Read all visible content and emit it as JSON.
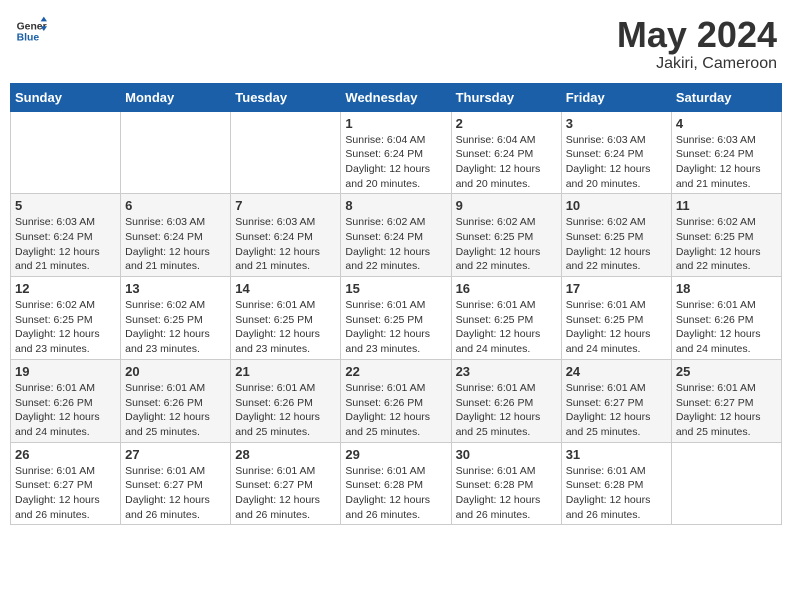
{
  "header": {
    "logo_line1": "General",
    "logo_line2": "Blue",
    "month": "May 2024",
    "location": "Jakiri, Cameroon"
  },
  "weekdays": [
    "Sunday",
    "Monday",
    "Tuesday",
    "Wednesday",
    "Thursday",
    "Friday",
    "Saturday"
  ],
  "weeks": [
    [
      {
        "day": "",
        "info": ""
      },
      {
        "day": "",
        "info": ""
      },
      {
        "day": "",
        "info": ""
      },
      {
        "day": "1",
        "info": "Sunrise: 6:04 AM\nSunset: 6:24 PM\nDaylight: 12 hours\nand 20 minutes."
      },
      {
        "day": "2",
        "info": "Sunrise: 6:04 AM\nSunset: 6:24 PM\nDaylight: 12 hours\nand 20 minutes."
      },
      {
        "day": "3",
        "info": "Sunrise: 6:03 AM\nSunset: 6:24 PM\nDaylight: 12 hours\nand 20 minutes."
      },
      {
        "day": "4",
        "info": "Sunrise: 6:03 AM\nSunset: 6:24 PM\nDaylight: 12 hours\nand 21 minutes."
      }
    ],
    [
      {
        "day": "5",
        "info": "Sunrise: 6:03 AM\nSunset: 6:24 PM\nDaylight: 12 hours\nand 21 minutes."
      },
      {
        "day": "6",
        "info": "Sunrise: 6:03 AM\nSunset: 6:24 PM\nDaylight: 12 hours\nand 21 minutes."
      },
      {
        "day": "7",
        "info": "Sunrise: 6:03 AM\nSunset: 6:24 PM\nDaylight: 12 hours\nand 21 minutes."
      },
      {
        "day": "8",
        "info": "Sunrise: 6:02 AM\nSunset: 6:24 PM\nDaylight: 12 hours\nand 22 minutes."
      },
      {
        "day": "9",
        "info": "Sunrise: 6:02 AM\nSunset: 6:25 PM\nDaylight: 12 hours\nand 22 minutes."
      },
      {
        "day": "10",
        "info": "Sunrise: 6:02 AM\nSunset: 6:25 PM\nDaylight: 12 hours\nand 22 minutes."
      },
      {
        "day": "11",
        "info": "Sunrise: 6:02 AM\nSunset: 6:25 PM\nDaylight: 12 hours\nand 22 minutes."
      }
    ],
    [
      {
        "day": "12",
        "info": "Sunrise: 6:02 AM\nSunset: 6:25 PM\nDaylight: 12 hours\nand 23 minutes."
      },
      {
        "day": "13",
        "info": "Sunrise: 6:02 AM\nSunset: 6:25 PM\nDaylight: 12 hours\nand 23 minutes."
      },
      {
        "day": "14",
        "info": "Sunrise: 6:01 AM\nSunset: 6:25 PM\nDaylight: 12 hours\nand 23 minutes."
      },
      {
        "day": "15",
        "info": "Sunrise: 6:01 AM\nSunset: 6:25 PM\nDaylight: 12 hours\nand 23 minutes."
      },
      {
        "day": "16",
        "info": "Sunrise: 6:01 AM\nSunset: 6:25 PM\nDaylight: 12 hours\nand 24 minutes."
      },
      {
        "day": "17",
        "info": "Sunrise: 6:01 AM\nSunset: 6:25 PM\nDaylight: 12 hours\nand 24 minutes."
      },
      {
        "day": "18",
        "info": "Sunrise: 6:01 AM\nSunset: 6:26 PM\nDaylight: 12 hours\nand 24 minutes."
      }
    ],
    [
      {
        "day": "19",
        "info": "Sunrise: 6:01 AM\nSunset: 6:26 PM\nDaylight: 12 hours\nand 24 minutes."
      },
      {
        "day": "20",
        "info": "Sunrise: 6:01 AM\nSunset: 6:26 PM\nDaylight: 12 hours\nand 25 minutes."
      },
      {
        "day": "21",
        "info": "Sunrise: 6:01 AM\nSunset: 6:26 PM\nDaylight: 12 hours\nand 25 minutes."
      },
      {
        "day": "22",
        "info": "Sunrise: 6:01 AM\nSunset: 6:26 PM\nDaylight: 12 hours\nand 25 minutes."
      },
      {
        "day": "23",
        "info": "Sunrise: 6:01 AM\nSunset: 6:26 PM\nDaylight: 12 hours\nand 25 minutes."
      },
      {
        "day": "24",
        "info": "Sunrise: 6:01 AM\nSunset: 6:27 PM\nDaylight: 12 hours\nand 25 minutes."
      },
      {
        "day": "25",
        "info": "Sunrise: 6:01 AM\nSunset: 6:27 PM\nDaylight: 12 hours\nand 25 minutes."
      }
    ],
    [
      {
        "day": "26",
        "info": "Sunrise: 6:01 AM\nSunset: 6:27 PM\nDaylight: 12 hours\nand 26 minutes."
      },
      {
        "day": "27",
        "info": "Sunrise: 6:01 AM\nSunset: 6:27 PM\nDaylight: 12 hours\nand 26 minutes."
      },
      {
        "day": "28",
        "info": "Sunrise: 6:01 AM\nSunset: 6:27 PM\nDaylight: 12 hours\nand 26 minutes."
      },
      {
        "day": "29",
        "info": "Sunrise: 6:01 AM\nSunset: 6:28 PM\nDaylight: 12 hours\nand 26 minutes."
      },
      {
        "day": "30",
        "info": "Sunrise: 6:01 AM\nSunset: 6:28 PM\nDaylight: 12 hours\nand 26 minutes."
      },
      {
        "day": "31",
        "info": "Sunrise: 6:01 AM\nSunset: 6:28 PM\nDaylight: 12 hours\nand 26 minutes."
      },
      {
        "day": "",
        "info": ""
      }
    ]
  ]
}
